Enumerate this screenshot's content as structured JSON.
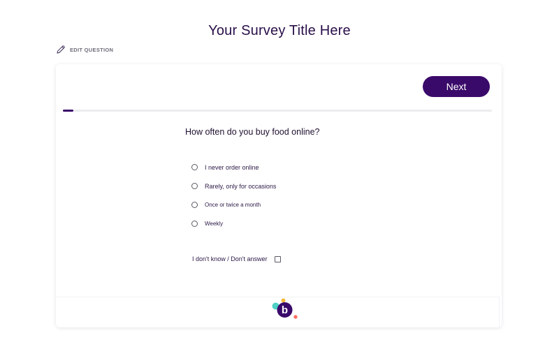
{
  "survey": {
    "title": "Your Survey Title Here"
  },
  "edit_question": {
    "label": "EDIT QUESTION",
    "icon": "pencil-icon"
  },
  "navigation": {
    "next_label": "Next"
  },
  "progress": {
    "fraction": 0.025
  },
  "question": {
    "text": "How often do you buy food online?",
    "options": [
      {
        "label": "I never order online",
        "selected": false
      },
      {
        "label": "Rarely, only for occasions",
        "selected": false
      },
      {
        "label": "Once or twice a month",
        "selected": false
      },
      {
        "label": "Weekly",
        "selected": false
      }
    ],
    "dont_know_label": "I don't know / Don't answer",
    "dont_know_checked": false
  },
  "brand": {
    "logo_letter": "b",
    "logo_icon": "brand-logo-icon",
    "colors": {
      "accent": "#3a0a6a",
      "teal": "#4fd1c5",
      "yellow": "#f6b93b",
      "coral": "#ff6b5a"
    }
  }
}
